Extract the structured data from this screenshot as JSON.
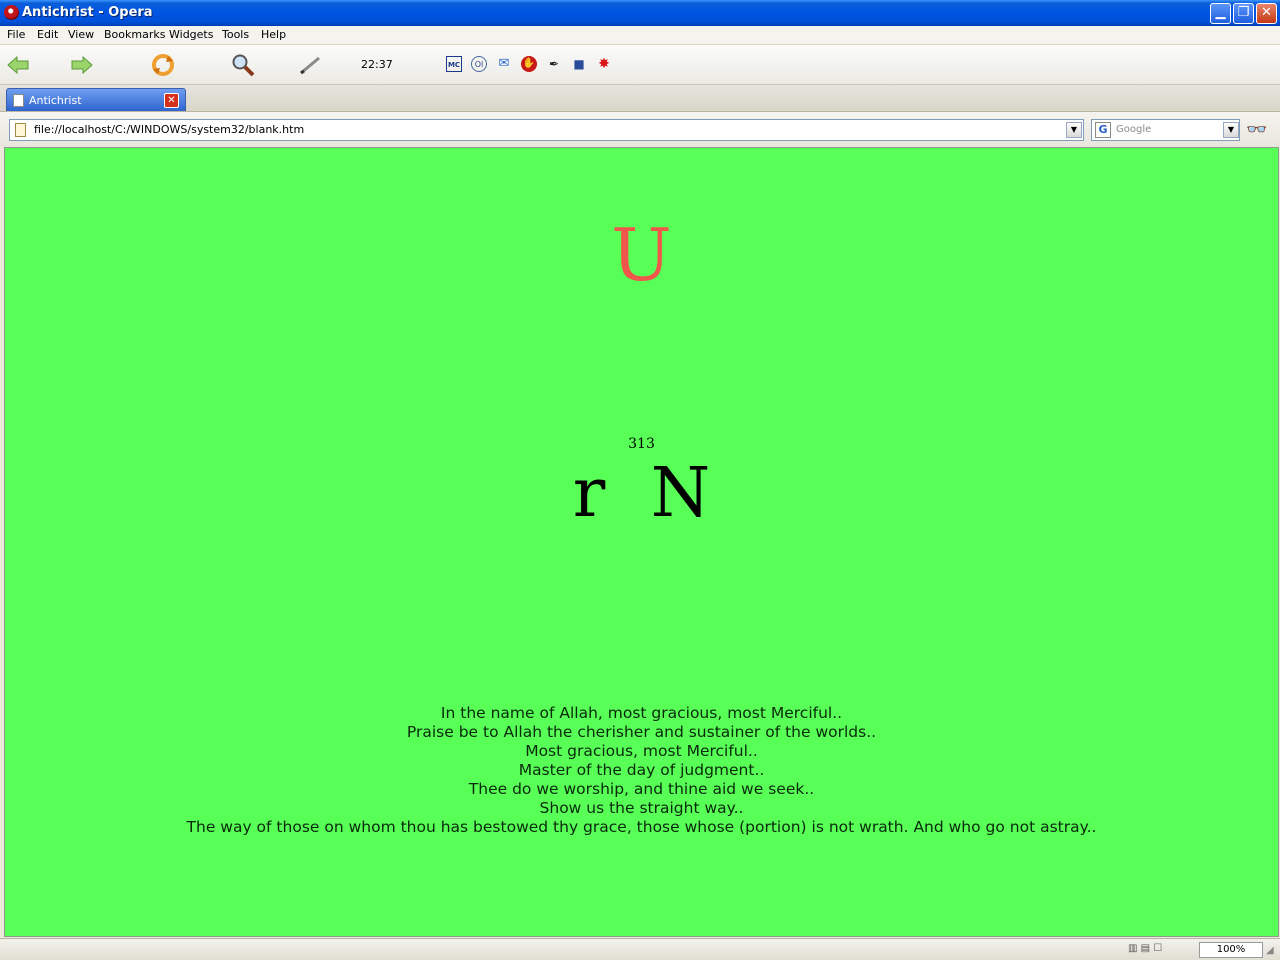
{
  "window": {
    "title": "Antichrist - Opera",
    "minimize_glyph": "▁",
    "restore_glyph": "❐",
    "close_glyph": "✕"
  },
  "menu": {
    "items": [
      "File",
      "Edit",
      "View",
      "Bookmarks",
      "Widgets",
      "Tools",
      "Help"
    ]
  },
  "toolbar": {
    "back_icon": "back-arrow-icon",
    "forward_icon": "forward-arrow-icon",
    "reload_icon": "reload-icon",
    "search_icon": "magnifier-icon",
    "pen_icon": "pen-icon",
    "clock": "22:37",
    "mini_icons": [
      "MC",
      "Ol",
      "✉",
      "✋",
      "✒",
      "■",
      "✸"
    ]
  },
  "tabs": [
    {
      "label": "Antichrist",
      "close_glyph": "✕"
    }
  ],
  "address": {
    "url": "file://localhost/C:/WINDOWS/system32/blank.htm",
    "dropdown_glyph": "▼",
    "search_engine_glyph": "G",
    "search_placeholder": "Google",
    "search_dropdown_glyph": "▼",
    "glasses_glyph": "👓"
  },
  "page": {
    "background_color": "#57ff57",
    "big_letter": "U",
    "big_letter_color": "#f0564a",
    "number": "313",
    "letters": "r N",
    "text_lines": [
      "In the name of Allah, most gracious, most Merciful..",
      "Praise be to Allah the cherisher and sustainer of the worlds..",
      "Most gracious, most Merciful..",
      "Master of the day of judgment..",
      "Thee do we worship, and thine aid we seek..",
      "Show us the straight way..",
      "The way of those on whom thou has bestowed thy grace, those whose (portion) is not wrath. And who go not astray.."
    ]
  },
  "statusbar": {
    "icons_text": "▥ ▤ ☐",
    "zoom": "100%",
    "grip_glyph": "◢"
  }
}
